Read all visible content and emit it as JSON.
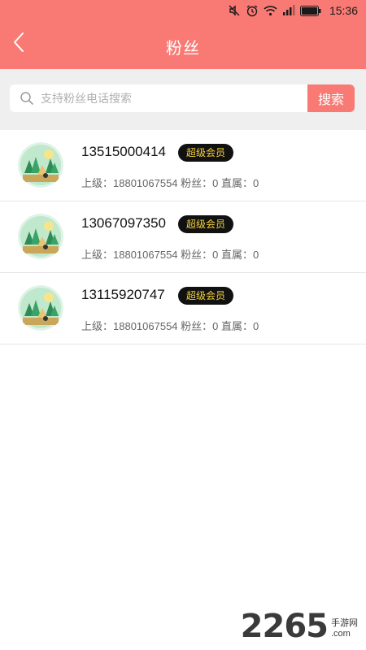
{
  "status_bar": {
    "time": "15:36",
    "icons": [
      "mute-icon",
      "alarm-icon",
      "wifi-icon",
      "signal-icon",
      "battery-icon"
    ]
  },
  "header": {
    "title": "粉丝",
    "back_icon": "chevron-left-icon",
    "bg_color": "#f97a74"
  },
  "search": {
    "placeholder": "支持粉丝电话搜索",
    "value": "",
    "button_label": "搜索"
  },
  "fans": [
    {
      "phone": "13515000414",
      "badge": "超级会员",
      "meta": "上级：18801067554 粉丝：0 直属：0"
    },
    {
      "phone": "13067097350",
      "badge": "超级会员",
      "meta": "上级：18801067554 粉丝：0 直属：0"
    },
    {
      "phone": "13115920747",
      "badge": "超级会员",
      "meta": "上级：18801067554 粉丝：0 直属：0"
    }
  ],
  "watermark": {
    "number": "2265",
    "suffix": "手游网",
    "domain": ".com"
  }
}
